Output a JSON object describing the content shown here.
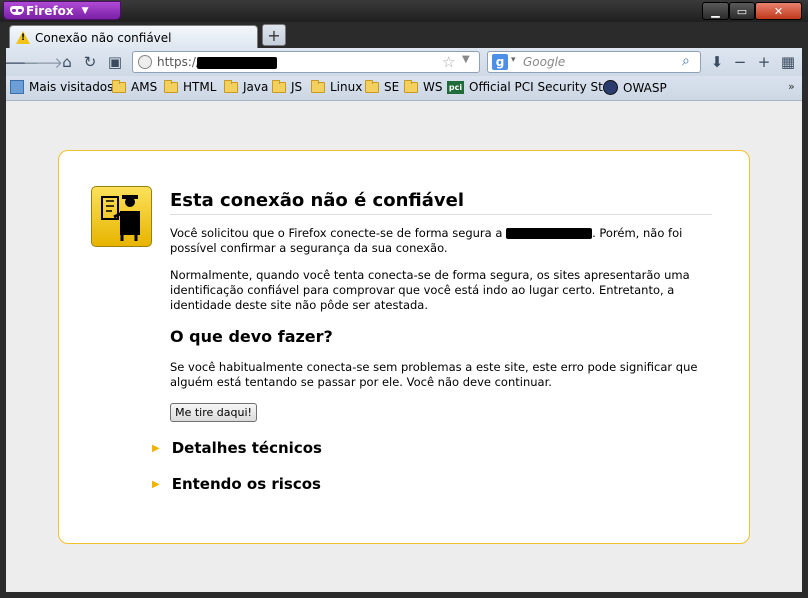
{
  "browser": {
    "app_button": "Firefox",
    "tab_title": "Conexão não confiável",
    "url_prefix": "https://",
    "search_placeholder": "Google",
    "new_tab_label": "+"
  },
  "bookmarks": [
    {
      "label": "Mais visitados",
      "icon": "most-visited-icon"
    },
    {
      "label": "AMS",
      "icon": "folder-icon"
    },
    {
      "label": "HTML",
      "icon": "folder-icon"
    },
    {
      "label": "Java",
      "icon": "folder-icon"
    },
    {
      "label": "JS",
      "icon": "folder-icon"
    },
    {
      "label": "Linux",
      "icon": "folder-icon"
    },
    {
      "label": "SE",
      "icon": "folder-icon"
    },
    {
      "label": "WS",
      "icon": "folder-icon"
    },
    {
      "label": "Official PCI Security St...",
      "icon": "pci-icon"
    },
    {
      "label": "OWASP",
      "icon": "owasp-icon"
    }
  ],
  "error_page": {
    "title": "Esta conexão não é confiável",
    "p1_a": "Você solicitou que o Firefox conecte-se de forma segura a",
    "p1_b": ". Porém, não foi possível confirmar a segurança da sua conexão.",
    "p2": "Normalmente, quando você tenta conecta-se de forma segura, os sites apresentarão uma identificação confiável para comprovar que você está indo ao lugar certo. Entretanto, a identidade deste site não pôde ser atestada.",
    "h2": "O que devo fazer?",
    "p3": "Se você habitualmente conecta-se sem problemas a este site, este erro pode significar que alguém está tentando se passar por ele. Você não deve continuar.",
    "button": "Me tire daqui!",
    "expander1": "Detalhes técnicos",
    "expander2": "Entendo os riscos"
  },
  "colors": {
    "card_border": "#f2c12e",
    "expander_arrow": "#f0b400",
    "firefox_button": "#8a2bb5"
  }
}
